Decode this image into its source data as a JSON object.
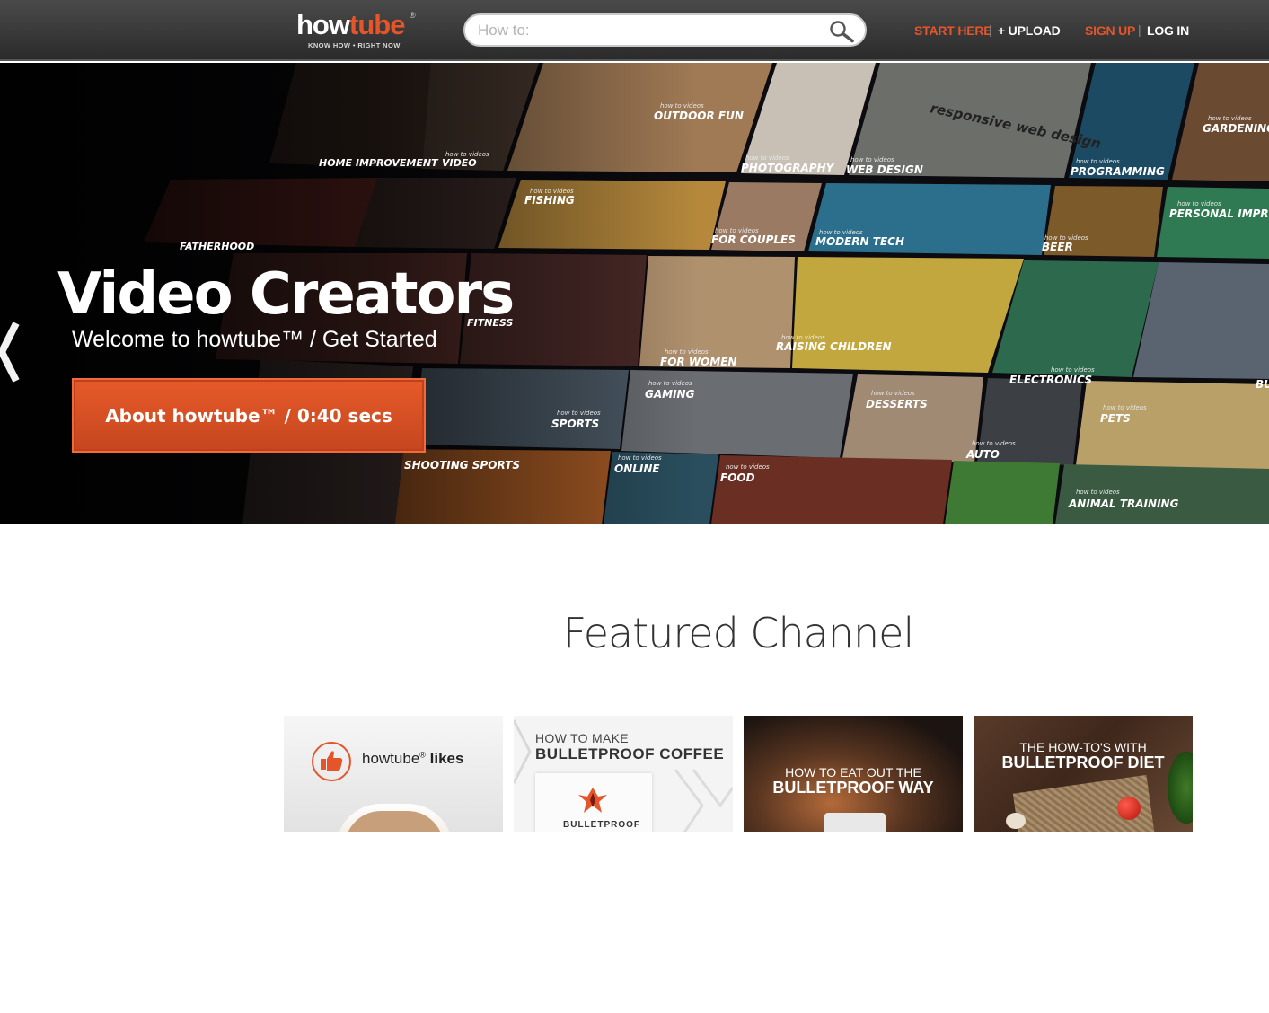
{
  "header": {
    "logo": {
      "word_main": "how",
      "word_accent": "tube",
      "registered": "®",
      "tagline": "KNOW HOW • RIGHT NOW"
    },
    "search": {
      "placeholder": "How to:",
      "value": "",
      "icon": "search-icon"
    },
    "nav": {
      "start_here": "START HERE",
      "upload": "+ UPLOAD",
      "sign_up": "SIGN UP",
      "log_in": "LOG IN",
      "separator": "|"
    },
    "colors": {
      "accent": "#e4552a",
      "bar": "#333333"
    }
  },
  "hero": {
    "title": "Video Creators",
    "subtitle": "Welcome to howtube™ / Get Started",
    "button": "About howtube™ / 0:40 secs",
    "prev_icon": "chevron-left-icon",
    "tiles": [
      {
        "small": "",
        "label": "HOME IMPROVEMENT"
      },
      {
        "small": "how to videos",
        "label": "VIDEO"
      },
      {
        "small": "how to videos",
        "label": "OUTDOOR FUN"
      },
      {
        "small": "how to videos",
        "label": "PHOTOGRAPHY"
      },
      {
        "small": "how to videos",
        "label": "WEB DESIGN"
      },
      {
        "small": "",
        "label": "responsive web design"
      },
      {
        "small": "how to videos",
        "label": "PROGRAMMING"
      },
      {
        "small": "how to videos",
        "label": "GARDENING"
      },
      {
        "small": "",
        "label": "FATHERHOOD"
      },
      {
        "small": "how to videos",
        "label": "FISHING"
      },
      {
        "small": "how to videos",
        "label": "FOR COUPLES"
      },
      {
        "small": "how to videos",
        "label": "MODERN TECH"
      },
      {
        "small": "how to videos",
        "label": "BEER"
      },
      {
        "small": "how to videos",
        "label": "PERSONAL IMPROVEMENT"
      },
      {
        "small": "",
        "label": "FITNESS"
      },
      {
        "small": "how to videos",
        "label": "FOR WOMEN"
      },
      {
        "small": "how to videos",
        "label": "RAISING CHILDREN"
      },
      {
        "small": "how to videos",
        "label": "ELECTRONICS"
      },
      {
        "small": "how to videos",
        "label": "SPORTS"
      },
      {
        "small": "how to videos",
        "label": "GAMING"
      },
      {
        "small": "how to videos",
        "label": "DESSERTS"
      },
      {
        "small": "how to videos",
        "label": "AUTO"
      },
      {
        "small": "how to videos",
        "label": "PETS"
      },
      {
        "small": "",
        "label": "SHOOTING SPORTS"
      },
      {
        "small": "how to videos",
        "label": "ONLINE"
      },
      {
        "small": "how to videos",
        "label": "FOOD"
      },
      {
        "small": "how to videos",
        "label": "ANIMAL TRAINING"
      },
      {
        "small": "",
        "label": "BU"
      }
    ]
  },
  "featured": {
    "title": "Featured Channel",
    "cards": [
      {
        "line1": "howtube",
        "reg": "®",
        "line2": "likes",
        "icon": "thumbs-up-icon"
      },
      {
        "line1": "HOW TO MAKE",
        "line2": "BULLETPROOF COFFEE",
        "bag_text": "BULLETPROOF"
      },
      {
        "line1": "HOW TO EAT OUT THE",
        "line2": "BULLETPROOF WAY"
      },
      {
        "line1": "THE HOW-TO'S WITH",
        "line2": "BULLETPROOF DIET"
      }
    ]
  }
}
